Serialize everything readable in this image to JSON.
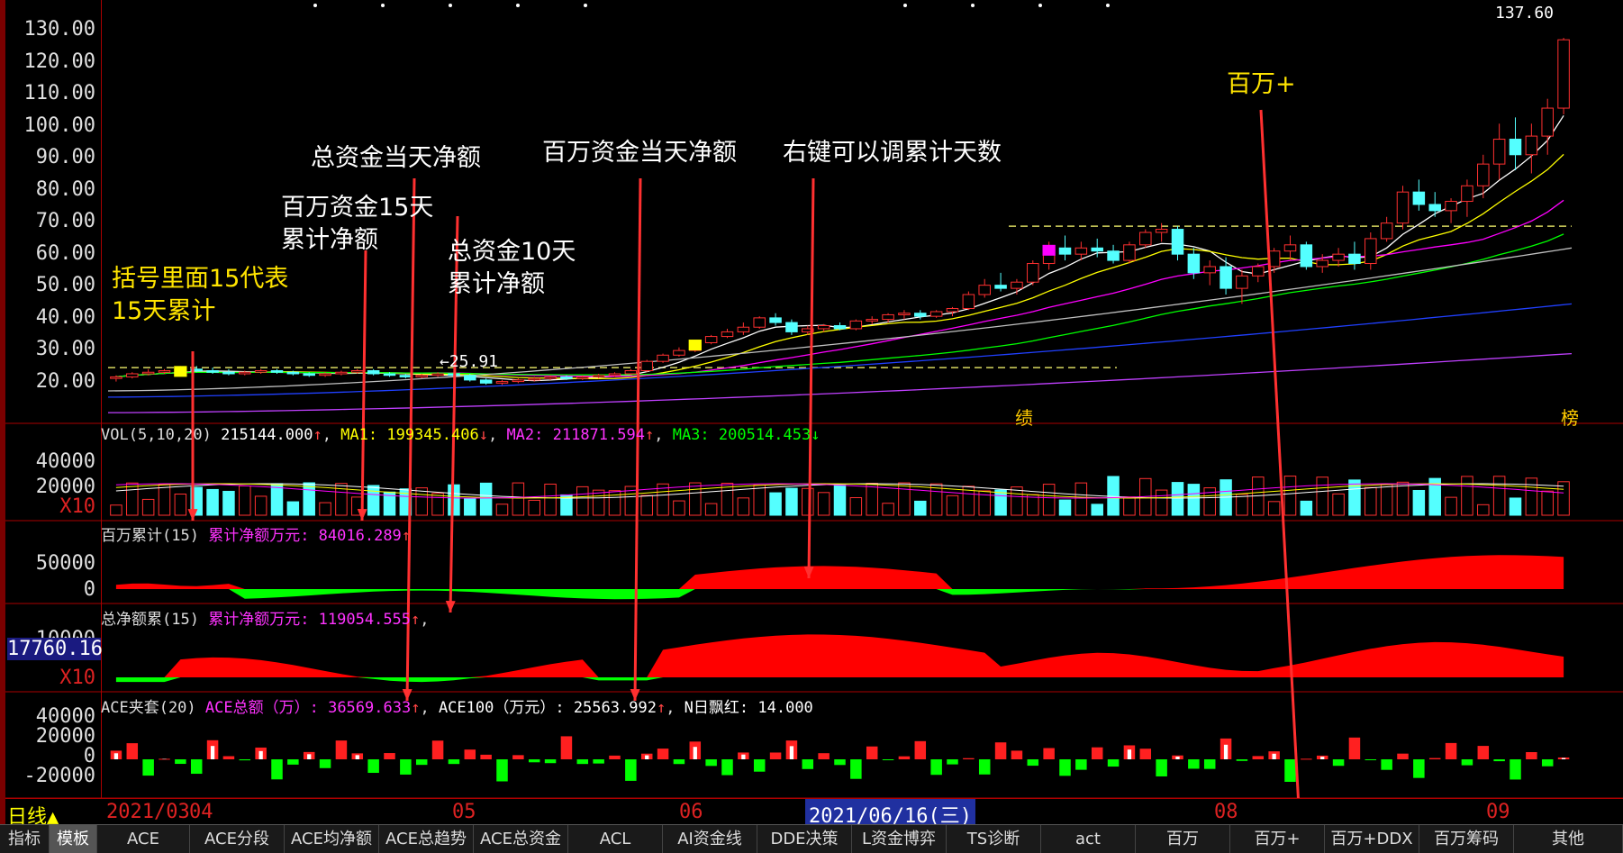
{
  "price_axis": [
    "130.00",
    "120.00",
    "110.00",
    "100.00",
    "90.00",
    "80.00",
    "70.00",
    "60.00",
    "50.00",
    "40.00",
    "30.00",
    "20.00"
  ],
  "price_high_label": "137.60",
  "price_low_label": "←25.91",
  "marker_chars": {
    "ji": "绩",
    "bang": "榜"
  },
  "vol": {
    "title": "VOL(5,10,20)",
    "value": "215144.000",
    "ma1": "MA1: 199345.406",
    "ma2": "MA2: 211871.594",
    "ma3": "MA3: 200514.453",
    "axis": [
      "40000",
      "20000"
    ],
    "unit": "X10"
  },
  "p3": {
    "title": "百万累计(15)",
    "sub": "累计净额万元: 84016.289",
    "axis": [
      "50000",
      "0"
    ]
  },
  "p4": {
    "title": "总净额累(15)",
    "sub": "累计净额万元: 119054.555",
    "axis": [
      "10000"
    ],
    "cur": "17760.16",
    "unit": "X10"
  },
  "p5": {
    "title": "ACE夹套(20)",
    "sub1": "ACE总额（万）: 36569.633",
    "sub2": "ACE100（万元）: 25563.992",
    "sub3": "N日飘红: 14.000",
    "axis": [
      "40000",
      "20000",
      "0",
      "-20000"
    ]
  },
  "annotations": {
    "a1": "括号里面15代表",
    "a1b": "15天累计",
    "a2": "百万资金15天",
    "a2b": "累计净额",
    "a3": "总资金当天净额",
    "a4": "总资金10天",
    "a4b": "累计净额",
    "a5": "百万资金当天净额",
    "a6": "右键可以调累计天数",
    "a7": "百万+"
  },
  "dates": {
    "period": "日线▲",
    "d1": "2021/03",
    "d2": "04",
    "d3": "05",
    "d4": "06",
    "d5": "2021/06/16(三)",
    "d6": "08",
    "d7": "09"
  },
  "tabs": [
    "指标",
    "模板",
    "ACE",
    "ACE分段",
    "ACE均净额",
    "ACE总趋势",
    "ACE总资金",
    "ACL",
    "AI资金线",
    "DDE决策",
    "L资金博弈",
    "TS诊断",
    "act",
    "百万",
    "百万+",
    "百万+DDX",
    "百万筹码",
    "其他"
  ],
  "colors": {
    "up": "#ff3030",
    "down": "#54ffff",
    "ma5": "#ffffff",
    "ma10": "#ffff00",
    "ma20": "#ff00ff",
    "ma60": "#00ff00",
    "ma120": "#c0c0c0",
    "ma250": "#2040ff"
  },
  "chart_data": {
    "type": "candlestick",
    "ylim": [
      15,
      140
    ],
    "candles": [
      [
        28,
        29,
        27,
        28.5
      ],
      [
        28.5,
        30,
        28,
        29.5
      ],
      [
        29.5,
        31,
        29,
        30
      ],
      [
        30,
        31,
        29.5,
        30.5
      ],
      [
        30.5,
        32,
        30,
        31
      ],
      [
        31,
        32,
        30,
        30.5
      ],
      [
        30.5,
        31.5,
        29.5,
        30
      ],
      [
        30,
        31,
        29,
        29.5
      ],
      [
        29.5,
        30.5,
        29,
        30
      ],
      [
        30,
        31,
        29.5,
        30.5
      ],
      [
        30.5,
        31,
        29.5,
        30
      ],
      [
        30,
        30.5,
        29,
        29.5
      ],
      [
        29.5,
        30,
        28.5,
        29
      ],
      [
        29,
        30,
        28.5,
        29.5
      ],
      [
        29.5,
        30.5,
        29,
        30
      ],
      [
        30,
        31,
        29.5,
        30.5
      ],
      [
        30.5,
        31,
        29,
        29.5
      ],
      [
        29.5,
        30,
        28.5,
        29
      ],
      [
        29,
        29.5,
        28,
        28.5
      ],
      [
        28.5,
        29.5,
        28,
        29
      ],
      [
        29,
        30,
        28.5,
        29.5
      ],
      [
        29.5,
        30,
        28.5,
        29
      ],
      [
        29,
        29.5,
        27,
        27.5
      ],
      [
        27.5,
        28,
        26,
        26.5
      ],
      [
        26.5,
        27.5,
        25.9,
        27
      ],
      [
        27,
        28,
        26.5,
        27.5
      ],
      [
        27.5,
        28.5,
        27,
        28
      ],
      [
        28,
        29,
        27.5,
        28.5
      ],
      [
        28.5,
        29,
        27.5,
        28
      ],
      [
        28,
        29,
        27.5,
        28.5
      ],
      [
        28.5,
        29.5,
        28,
        29
      ],
      [
        29,
        30,
        28.5,
        29.5
      ],
      [
        29.5,
        31,
        29,
        30.5
      ],
      [
        30.5,
        34,
        30,
        33.5
      ],
      [
        33.5,
        36,
        33,
        35.5
      ],
      [
        35.5,
        38,
        35,
        37
      ],
      [
        37,
        40,
        36.5,
        39.5
      ],
      [
        39.5,
        42,
        39,
        41.5
      ],
      [
        41.5,
        44,
        41,
        43
      ],
      [
        43,
        46,
        42,
        44.5
      ],
      [
        44.5,
        48,
        44,
        47.5
      ],
      [
        47.5,
        49,
        45,
        46
      ],
      [
        46,
        47,
        42,
        43
      ],
      [
        43,
        45,
        42,
        44
      ],
      [
        44,
        45.5,
        43,
        45
      ],
      [
        45,
        46,
        43.5,
        44
      ],
      [
        44,
        47,
        43.5,
        46.5
      ],
      [
        46.5,
        48,
        45.5,
        47
      ],
      [
        47,
        49,
        46,
        48.5
      ],
      [
        48.5,
        50,
        47,
        49
      ],
      [
        49,
        50,
        47,
        48
      ],
      [
        48,
        50,
        47.5,
        49.5
      ],
      [
        49.5,
        51,
        48,
        50.5
      ],
      [
        50.5,
        56,
        50,
        55
      ],
      [
        55,
        60,
        54,
        58
      ],
      [
        58,
        62,
        56,
        57
      ],
      [
        57,
        60,
        55,
        59
      ],
      [
        59,
        66,
        58,
        65
      ],
      [
        65,
        72,
        63,
        70
      ],
      [
        70,
        74,
        66,
        68
      ],
      [
        68,
        72,
        66,
        70
      ],
      [
        70,
        73,
        67,
        69
      ],
      [
        69,
        71,
        65,
        66
      ],
      [
        66,
        72,
        65,
        71
      ],
      [
        71,
        76,
        70,
        75
      ],
      [
        75,
        78,
        72,
        76
      ],
      [
        76,
        77,
        66,
        68
      ],
      [
        68,
        70,
        60,
        62
      ],
      [
        62,
        66,
        58,
        64
      ],
      [
        64,
        67,
        55,
        57
      ],
      [
        57,
        63,
        52,
        61
      ],
      [
        61,
        65,
        59,
        64
      ],
      [
        64,
        70,
        62,
        69
      ],
      [
        69,
        74,
        66,
        71
      ],
      [
        71,
        72,
        63,
        64
      ],
      [
        64,
        68,
        62,
        66
      ],
      [
        66,
        70,
        64,
        68
      ],
      [
        68,
        72,
        63,
        65
      ],
      [
        65,
        75,
        63,
        73
      ],
      [
        73,
        80,
        72,
        78
      ],
      [
        78,
        90,
        76,
        88
      ],
      [
        88,
        92,
        82,
        84
      ],
      [
        84,
        88,
        80,
        82
      ],
      [
        82,
        86,
        78,
        85
      ],
      [
        85,
        92,
        80,
        90
      ],
      [
        90,
        100,
        86,
        97
      ],
      [
        97,
        110,
        92,
        105
      ],
      [
        105,
        112,
        95,
        100
      ],
      [
        100,
        110,
        94,
        106
      ],
      [
        106,
        118,
        100,
        115
      ],
      [
        115,
        137.6,
        113,
        137
      ]
    ]
  }
}
